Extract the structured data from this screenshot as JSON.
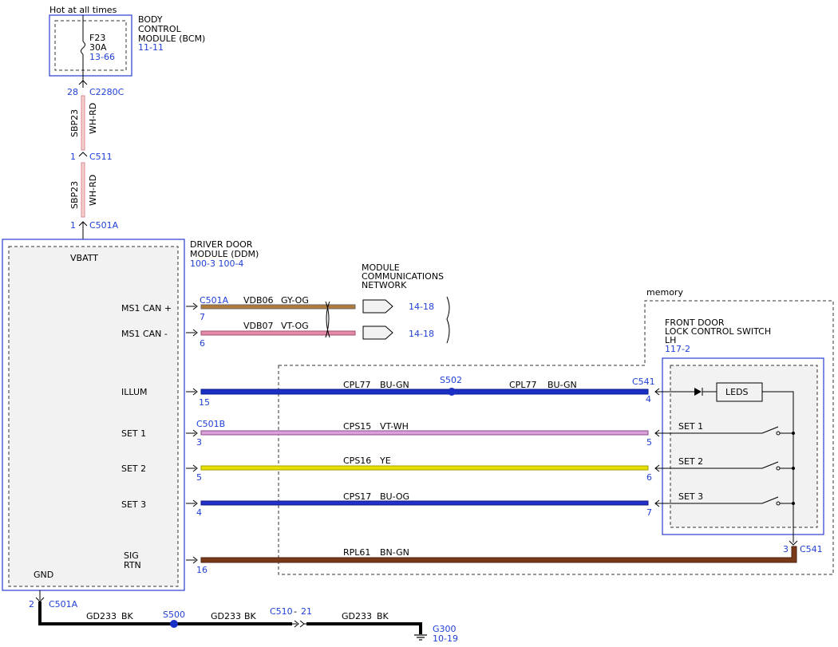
{
  "top": {
    "hot_label": "Hot at all times",
    "bcm_name": [
      "BODY",
      "CONTROL",
      "MODULE (BCM)"
    ],
    "bcm_ref": "11-11",
    "fuse_id": "F23",
    "fuse_rating": "30A",
    "fuse_ref": "13-66"
  },
  "vbatt_wire": {
    "pin_bcm": "28",
    "conn_bcm": "C2280C",
    "circuit": "SBP23",
    "color": "WH-RD",
    "pin_mid": "1",
    "conn_mid": "C511",
    "pin_ddm": "1",
    "conn_ddm": "C501A"
  },
  "ddm": {
    "name": [
      "DRIVER DOOR",
      "MODULE (DDM)"
    ],
    "ref": "100-3 100-4",
    "vbatt": "VBATT",
    "gnd": "GND",
    "pins": {
      "can_plus": "MS1 CAN +",
      "can_minus": "MS1 CAN -",
      "illum": "ILLUM",
      "set1": "SET 1",
      "set2": "SET 2",
      "set3": "SET 3",
      "sig_rtn": [
        "SIG",
        "RTN"
      ]
    }
  },
  "network": {
    "name": [
      "MODULE",
      "COMMUNICATIONS",
      "NETWORK"
    ],
    "conn": "C501A",
    "can_plus": {
      "pin": "7",
      "circuit": "VDB06",
      "color": "GY-OG",
      "ref": "14-18"
    },
    "can_minus": {
      "pin": "6",
      "circuit": "VDB07",
      "color": "VT-OG",
      "ref": "14-18"
    }
  },
  "memory_label": "memory",
  "switch": {
    "name": [
      "FRONT DOOR",
      "LOCK CONTROL SWITCH",
      "LH"
    ],
    "ref": "117-2",
    "leds": "LEDS",
    "set1": "SET 1",
    "set2": "SET 2",
    "set3": "SET 3",
    "conn": "C541",
    "rtn_pin": "3"
  },
  "wires": {
    "illum": {
      "pin_ddm": "15",
      "circuit": "CPL77",
      "color": "BU-GN",
      "splice": "S502",
      "pin_sw": "4",
      "conn_sw": "C541"
    },
    "set1": {
      "conn": "C501B",
      "pin_ddm": "3",
      "circuit": "CPS15",
      "color": "VT-WH",
      "pin_sw": "5"
    },
    "set2": {
      "pin_ddm": "5",
      "circuit": "CPS16",
      "color": "YE",
      "pin_sw": "6"
    },
    "set3": {
      "pin_ddm": "4",
      "circuit": "CPS17",
      "color": "BU-OG",
      "pin_sw": "7"
    },
    "rtn": {
      "pin_ddm": "16",
      "circuit": "RPL61",
      "color": "BN-GN"
    }
  },
  "ground": {
    "pin": "2",
    "conn": "C501A",
    "circuit": "GD233",
    "color": "BK",
    "splice": "S500",
    "inline_conn": "C510",
    "inline_pin": "21",
    "ground_id": "G300",
    "ground_ref": "10-19"
  },
  "palette": {
    "blue_label": "#1f3fd6",
    "wire_wh_rd": "#d98a8a",
    "wire_gy_og": "#b07a3a",
    "wire_vt_og": "#e48aa8",
    "wire_bu_gn": "#1a2fc4",
    "wire_vt_wh": "#d9a0d9",
    "wire_ye": "#e8e000",
    "wire_bu_og": "#2030c8",
    "wire_bn_gn": "#7a3a1a",
    "wire_bk": "#000000"
  }
}
